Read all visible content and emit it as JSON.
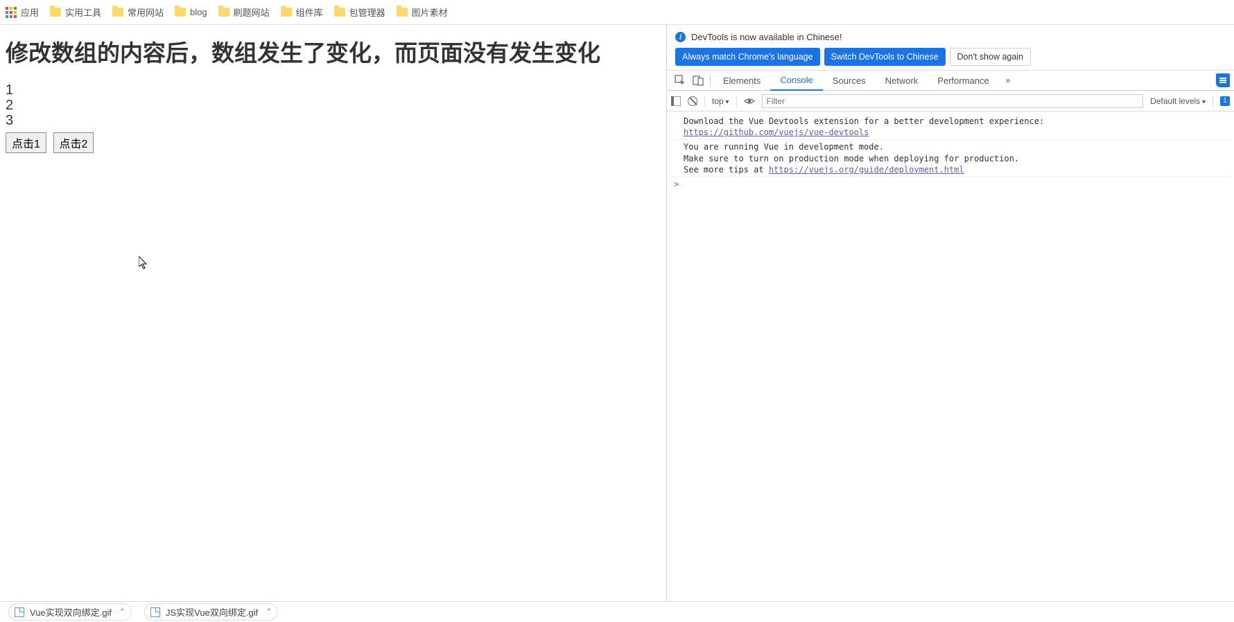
{
  "bookmarks": {
    "apps_label": "应用",
    "items": [
      "实用工具",
      "常用网站",
      "blog",
      "刷题网站",
      "组件库",
      "包管理器",
      "图片素材"
    ]
  },
  "page": {
    "title": "修改数组的内容后，数组发生了变化，而页面没有发生变化",
    "list": [
      "1",
      "2",
      "3"
    ],
    "btn1": "点击1",
    "btn2": "点击2"
  },
  "devtools": {
    "infobar": {
      "message": "DevTools is now available in Chinese!",
      "always_match": "Always match Chrome's language",
      "switch_btn": "Switch DevTools to Chinese",
      "dont_show": "Don't show again"
    },
    "tabs": {
      "elements": "Elements",
      "console": "Console",
      "sources": "Sources",
      "network": "Network",
      "performance": "Performance"
    },
    "console_toolbar": {
      "context": "top",
      "filter_placeholder": "Filter",
      "levels": "Default levels",
      "issues_count": "1"
    },
    "console": {
      "line1": "Download the Vue Devtools extension for a better development experience:",
      "link1": "https://github.com/vuejs/vue-devtools",
      "line2": "You are running Vue in development mode.",
      "line3": "Make sure to turn on production mode when deploying for production.",
      "line4a": "See more tips at ",
      "link2": "https://vuejs.org/guide/deployment.html",
      "prompt": ">"
    }
  },
  "downloads": {
    "item1": "Vue实现双向绑定.gif",
    "item2": "JS实现Vue双向绑定.gif"
  }
}
